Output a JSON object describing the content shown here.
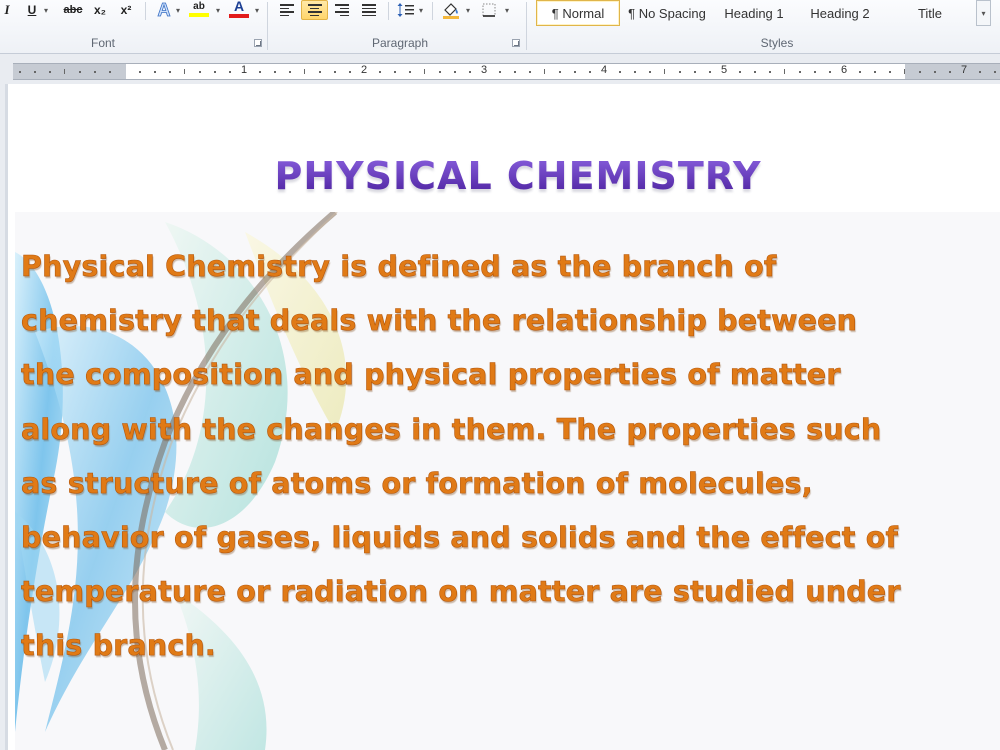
{
  "ribbon": {
    "font_group_label": "Font",
    "paragraph_group_label": "Paragraph",
    "styles_group_label": "Styles",
    "font_buttons": {
      "italic": "I",
      "underline": "U",
      "strikethrough": "abc",
      "subscript": "x₂",
      "superscript": "x²",
      "text_effects": "A",
      "highlight": "ab",
      "font_color": "A"
    },
    "styles": [
      {
        "label": "¶ Normal",
        "selected": true
      },
      {
        "label": "¶ No Spacing",
        "selected": false
      },
      {
        "label": "Heading 1",
        "selected": false
      },
      {
        "label": "Heading 2",
        "selected": false
      },
      {
        "label": "Title",
        "selected": false
      }
    ],
    "colors": {
      "highlight": "#ffff00",
      "font_color": "#e21b1b",
      "active_button": "#ffd56a"
    }
  },
  "ruler": {
    "numbers": [
      "1",
      "2",
      "3",
      "4",
      "5",
      "6",
      "7"
    ]
  },
  "document": {
    "title": "PHYSICAL CHEMISTRY",
    "lines": [
      "Physical Chemistry is defined as the branch of",
      "chemistry that deals with the relationship between",
      "the composition and physical properties of matter",
      "along with the changes in them. The properties such",
      "as structure of atoms or formation of molecules,",
      "behavior of gases, liquids and solids and the effect of",
      "temperature or radiation on matter are studied under",
      "this branch."
    ],
    "colors": {
      "title": "#6a3fc0",
      "body": "#e07a16"
    }
  }
}
